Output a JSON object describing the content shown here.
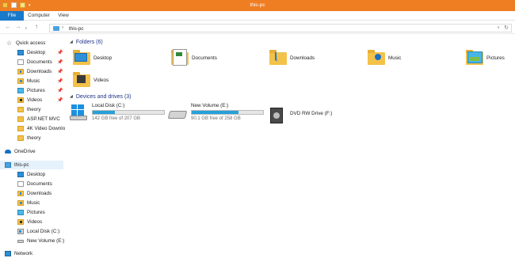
{
  "window": {
    "title": "this-pc",
    "accent": "#ef7d22",
    "qat_icons": [
      "properties-icon",
      "new-folder-icon",
      "folder-icon"
    ]
  },
  "ribbon": {
    "tabs": [
      "File",
      "Computer",
      "View"
    ],
    "file_color": "#1979ca"
  },
  "address": {
    "back": "←",
    "forward": "→",
    "recent": "∨",
    "up": "↑",
    "path": "this-pc",
    "separator": "›",
    "dropdown": "∨",
    "refresh": "↻"
  },
  "sidebar": {
    "quick_access": "Quick access",
    "pinned": [
      {
        "label": "Desktop",
        "icon": "desktop-icon"
      },
      {
        "label": "Documents",
        "icon": "documents-icon"
      },
      {
        "label": "Downloads",
        "icon": "downloads-icon"
      },
      {
        "label": "Music",
        "icon": "music-icon"
      },
      {
        "label": "Pictures",
        "icon": "pictures-icon"
      },
      {
        "label": "Videos",
        "icon": "videos-icon"
      }
    ],
    "recent": [
      {
        "label": "theory"
      },
      {
        "label": "ASP.NET MVC"
      },
      {
        "label": "4K Video Downlo"
      },
      {
        "label": "theory"
      }
    ],
    "onedrive": "OneDrive",
    "this_pc": "this-pc",
    "this_pc_children": [
      {
        "label": "Desktop"
      },
      {
        "label": "Documents"
      },
      {
        "label": "Downloads"
      },
      {
        "label": "Music"
      },
      {
        "label": "Pictures"
      },
      {
        "label": "Videos"
      },
      {
        "label": "Local Disk (C:)"
      },
      {
        "label": "New Volume (E:)"
      }
    ],
    "network": "Network",
    "pin_glyph": "📌"
  },
  "main": {
    "folders_header": "Folders (6)",
    "folders": [
      {
        "label": "Desktop"
      },
      {
        "label": "Documents"
      },
      {
        "label": "Downloads"
      },
      {
        "label": "Music"
      },
      {
        "label": "Pictures"
      },
      {
        "label": "Videos"
      }
    ],
    "drives_header": "Devices and drives (3)",
    "drives": [
      {
        "name": "Local Disk (C:)",
        "free": "142 GB free of 207 GB",
        "used_fraction": 0.31
      },
      {
        "name": "New Volume (E:)",
        "free": "90.1 GB free of 258 GB",
        "used_fraction": 0.65
      },
      {
        "name": "DVD RW Drive (F:)"
      }
    ],
    "bar_color": "#26a0da"
  }
}
